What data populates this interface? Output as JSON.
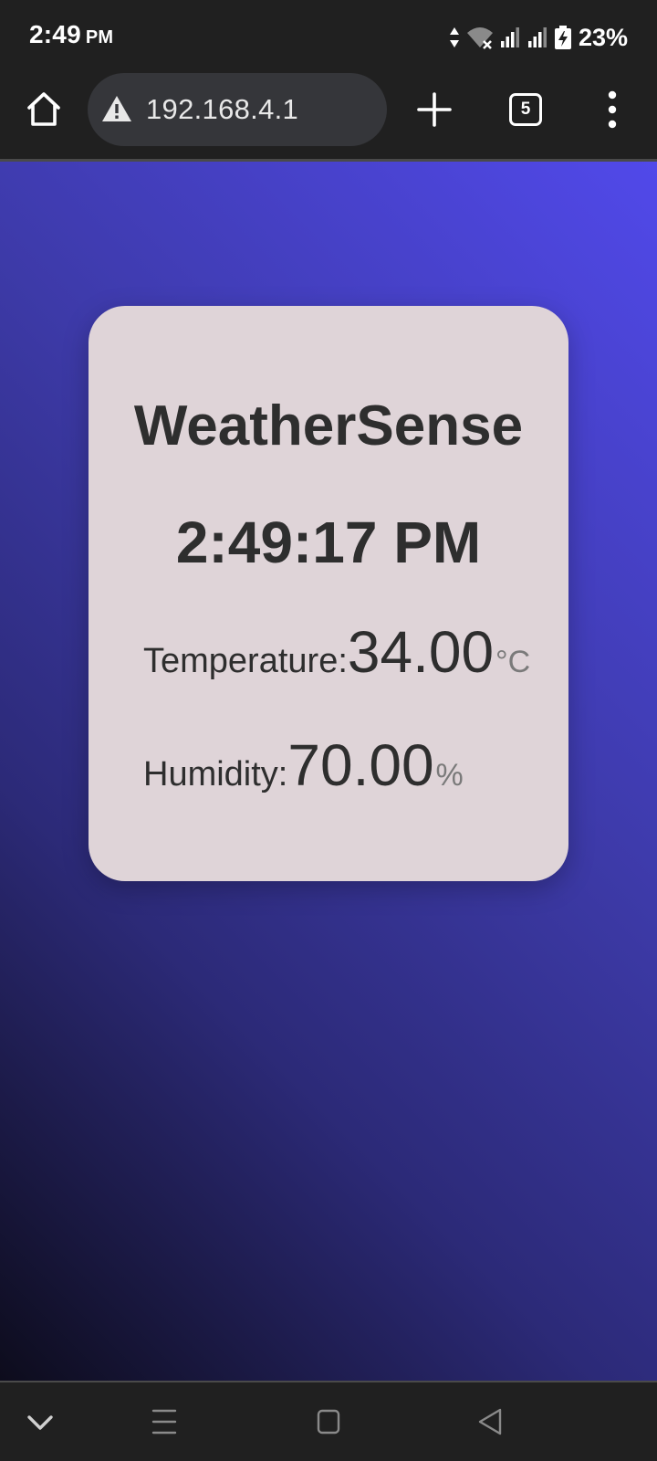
{
  "status_bar": {
    "time": "2:49",
    "ampm": "PM",
    "battery_percent": "23%",
    "icons": [
      "data-arrows-icon",
      "wifi-off-icon",
      "signal-bars-icon",
      "signal-bars-icon",
      "battery-charging-icon"
    ]
  },
  "browser": {
    "url": "192.168.4.1",
    "tab_count": "5",
    "icons": {
      "home": "home-icon",
      "security": "warning-triangle-icon",
      "new_tab": "plus-icon",
      "menu": "more-vertical-icon"
    }
  },
  "weather_card": {
    "title": "WeatherSense",
    "clock": "2:49:17 PM",
    "temperature": {
      "label": "Temperature:",
      "value": "34.00",
      "unit": "°C"
    },
    "humidity": {
      "label": "Humidity:",
      "value": "70.00",
      "unit": "%"
    }
  },
  "colors": {
    "card_background": "#dfd4d8",
    "gradient_top_right": "#5149ea",
    "gradient_bottom_left": "#0d0c1c",
    "chrome_background": "#202020"
  },
  "nav_bar": {
    "icons": [
      "chevron-down-icon",
      "recents-icon",
      "home-square-icon",
      "back-triangle-icon"
    ]
  }
}
